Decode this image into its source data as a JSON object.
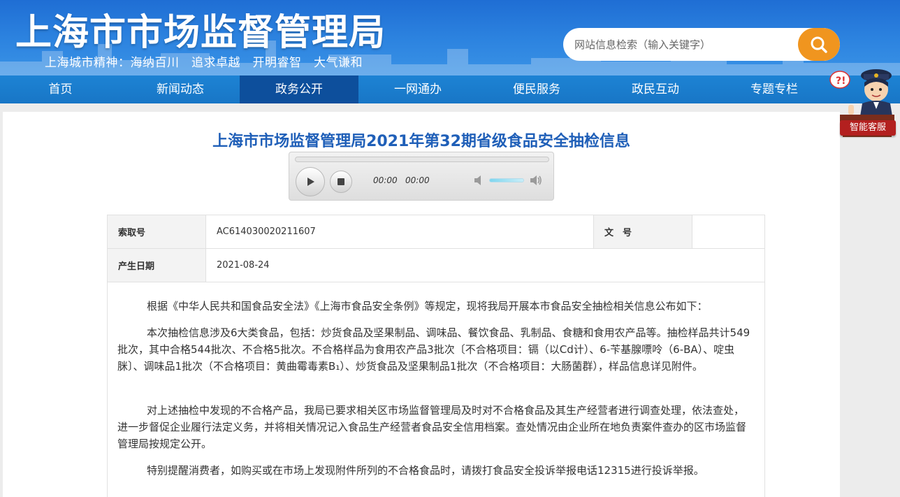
{
  "header": {
    "site_title": "上海市市场监督管理局",
    "slogan": "上海城市精神：海纳百川　追求卓越　开明睿智　大气谦和",
    "search_placeholder": "网站信息检索（输入关键字）",
    "accent_color": "#f0951f"
  },
  "nav": {
    "items": [
      {
        "label": "首页"
      },
      {
        "label": "新闻动态"
      },
      {
        "label": "政务公开",
        "active": true
      },
      {
        "label": "一网通办"
      },
      {
        "label": "便民服务"
      },
      {
        "label": "政民互动"
      },
      {
        "label": "专题专栏"
      }
    ]
  },
  "helper": {
    "label": "智能客服"
  },
  "article": {
    "title": "上海市市场监督管理局2021年第32期省级食品安全抽检信息"
  },
  "player": {
    "current_time": "00:00",
    "duration": "00:00"
  },
  "meta": {
    "index_label": "索取号",
    "index_value": "AC614030020211607",
    "doc_label": "文　号",
    "doc_value": "",
    "date_label": "产生日期",
    "date_value": "2021-08-24"
  },
  "body": {
    "p1": "根据《中华人民共和国食品安全法》《上海市食品安全条例》等规定，现将我局开展本市食品安全抽检相关信息公布如下：",
    "p2": "本次抽检信息涉及6大类食品，包括：炒货食品及坚果制品、调味品、餐饮食品、乳制品、食糖和食用农产品等。抽检样品共计549批次，其中合格544批次、不合格5批次。不合格样品为食用农产品3批次〔不合格项目：镉（以Cd计）、6-苄基腺嘌呤（6-BA）、啶虫脒〕、调味品1批次（不合格项目：黄曲霉毒素B₁）、炒货食品及坚果制品1批次（不合格项目：大肠菌群），样品信息详见附件。",
    "p3": "对上述抽检中发现的不合格产品，我局已要求相关区市场监督管理局及时对不合格食品及其生产经营者进行调查处理，依法查处，进一步督促企业履行法定义务，并将相关情况记入食品生产经营者食品安全信用档案。查处情况由企业所在地负责案件查办的区市场监督管理局按规定公开。",
    "p4": "特别提醒消费者，如购买或在市场上发现附件所列的不合格食品时，请拨打食品安全投诉举报电话12315进行投诉举报。"
  }
}
